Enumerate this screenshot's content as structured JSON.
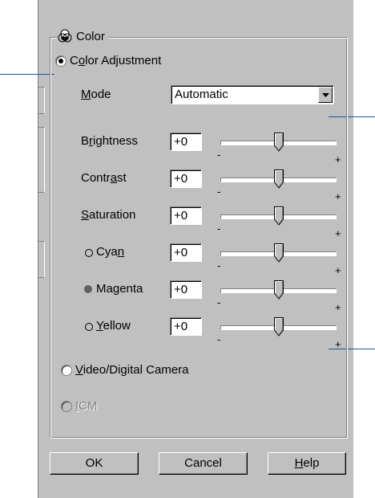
{
  "group": {
    "title": "Color"
  },
  "color_adjustment": {
    "label_pre": "C",
    "label_ul": "o",
    "label_post": "lor Adjustment",
    "selected": true
  },
  "mode": {
    "label_ul": "M",
    "label_post": "ode",
    "value": "Automatic"
  },
  "sliders": [
    {
      "pre": "B",
      "ul": "r",
      "post": "ightness",
      "value": "+0",
      "level": 0.5,
      "marker": "none"
    },
    {
      "pre": "Contr",
      "ul": "a",
      "post": "st",
      "value": "+0",
      "level": 0.5,
      "marker": "none"
    },
    {
      "pre": "",
      "ul": "S",
      "post": "aturation",
      "value": "+0",
      "level": 0.5,
      "marker": "none"
    },
    {
      "pre": "Cya",
      "ul": "n",
      "post": "",
      "value": "+0",
      "level": 0.5,
      "marker": "hollow"
    },
    {
      "pre": "Ma",
      "ul": "g",
      "post": "enta",
      "value": "+0",
      "level": 0.5,
      "marker": "filled"
    },
    {
      "pre": "",
      "ul": "Y",
      "post": "ellow",
      "value": "+0",
      "level": 0.5,
      "marker": "hollow"
    }
  ],
  "ticks": {
    "min": "-",
    "max": "+"
  },
  "video": {
    "pre": "",
    "ul": "V",
    "post": "ideo/Digital Camera",
    "selected": false
  },
  "icm": {
    "pre": "",
    "ul": "I",
    "post": "CM",
    "selected": false,
    "disabled": true
  },
  "buttons": {
    "ok": "OK",
    "cancel": "Cancel",
    "help_ul": "H",
    "help_post": "elp"
  },
  "colors": {
    "dialog": "#c0c0c0",
    "callout": "#1f55a8"
  }
}
